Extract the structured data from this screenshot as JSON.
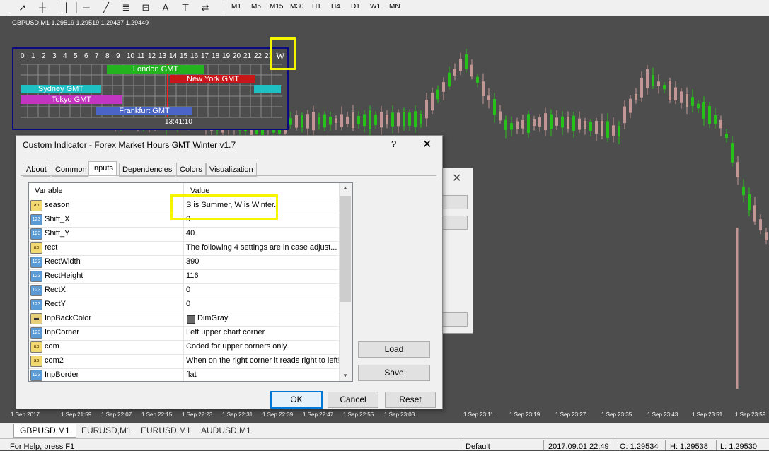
{
  "toolbar": {
    "icons": [
      "cursor-icon",
      "crosshair-icon",
      "vertical-line-icon",
      "horizontal-line-icon",
      "trendline-icon",
      "fibonacci-icon",
      "label-icon",
      "text-icon",
      "text-label-icon",
      "arrows-icon"
    ],
    "text_tool": "A",
    "timeframes": [
      "M1",
      "M5",
      "M15",
      "M30",
      "H1",
      "H4",
      "D1",
      "W1",
      "MN"
    ]
  },
  "chart": {
    "title": "GBPUSD,M1  1.29519 1.29519 1.29437 1.29449",
    "time_labels": [
      "1 Sep 2017",
      "1 Sep 21:59",
      "1 Sep 22:07",
      "1 Sep 22:15",
      "1 Sep 22:23",
      "1 Sep 22:31",
      "1 Sep 22:39",
      "1 Sep 22:47",
      "1 Sep 22:55",
      "1 Sep 23:03",
      "1 Sep 23:11",
      "1 Sep 23:19",
      "1 Sep 23:27",
      "1 Sep 23:35",
      "1 Sep 23:43",
      "1 Sep 23:51",
      "1 Sep 23:59"
    ],
    "up_color": "#26c21a",
    "down_color": "#c39696"
  },
  "market_hours": {
    "hours": [
      "0",
      "1",
      "2",
      "3",
      "4",
      "5",
      "6",
      "7",
      "8",
      "9",
      "10",
      "11",
      "12",
      "13",
      "14",
      "15",
      "16",
      "17",
      "18",
      "19",
      "20",
      "21",
      "22",
      "23"
    ],
    "season_letter": "W",
    "time": "13:41:10",
    "sessions": [
      {
        "name": "London GMT",
        "color": "#22b31e"
      },
      {
        "name": "New York GMT",
        "color": "#c8161a"
      },
      {
        "name": "Sydney GMT",
        "color": "#1fc0c4"
      },
      {
        "name": "Tokyo GMT",
        "color": "#c234c2"
      },
      {
        "name": "Frankfurt GMT",
        "color": "#4a64c8"
      }
    ]
  },
  "dialog": {
    "title": "Custom Indicator - Forex Market Hours GMT Winter v1.7",
    "help": "?",
    "tabs": [
      "About",
      "Common",
      "Inputs",
      "Dependencies",
      "Colors",
      "Visualization"
    ],
    "active_tab": "Inputs",
    "columns": {
      "variable": "Variable",
      "value": "Value"
    },
    "rows": [
      {
        "type": "ab",
        "name": "season",
        "value": "S is Summer, W is Winter."
      },
      {
        "type": "123",
        "name": "Shift_X",
        "value": "0"
      },
      {
        "type": "123",
        "name": "Shift_Y",
        "value": "40"
      },
      {
        "type": "ab",
        "name": "rect",
        "value": "The following 4 settings are in case adjust..."
      },
      {
        "type": "123",
        "name": "RectWidth",
        "value": "390"
      },
      {
        "type": "123",
        "name": "RectHeight",
        "value": "116"
      },
      {
        "type": "123",
        "name": "RectX",
        "value": "0"
      },
      {
        "type": "123",
        "name": "RectY",
        "value": "0"
      },
      {
        "type": "color",
        "name": "InpBackColor",
        "value": "DimGray"
      },
      {
        "type": "123",
        "name": "InpCorner",
        "value": "Left upper chart corner"
      },
      {
        "type": "ab",
        "name": "com",
        "value": "Coded for upper corners only."
      },
      {
        "type": "ab",
        "name": "com2",
        "value": "When on the right corner it reads right to left!"
      },
      {
        "type": "123",
        "name": "InpBorder",
        "value": "flat"
      }
    ],
    "load": "Load",
    "save": "Save",
    "ok": "OK",
    "cancel": "Cancel",
    "reset": "Reset"
  },
  "bottom_tabs": [
    "GBPUSD,M1",
    "EURUSD,M1",
    "EURUSD,M1",
    "AUDUSD,M1"
  ],
  "status": {
    "help": "For Help, press F1",
    "profile": "Default",
    "datetime": "2017.09.01 22:49",
    "open": "O: 1.29534",
    "high": "H: 1.29538",
    "low": "L: 1.29530"
  }
}
